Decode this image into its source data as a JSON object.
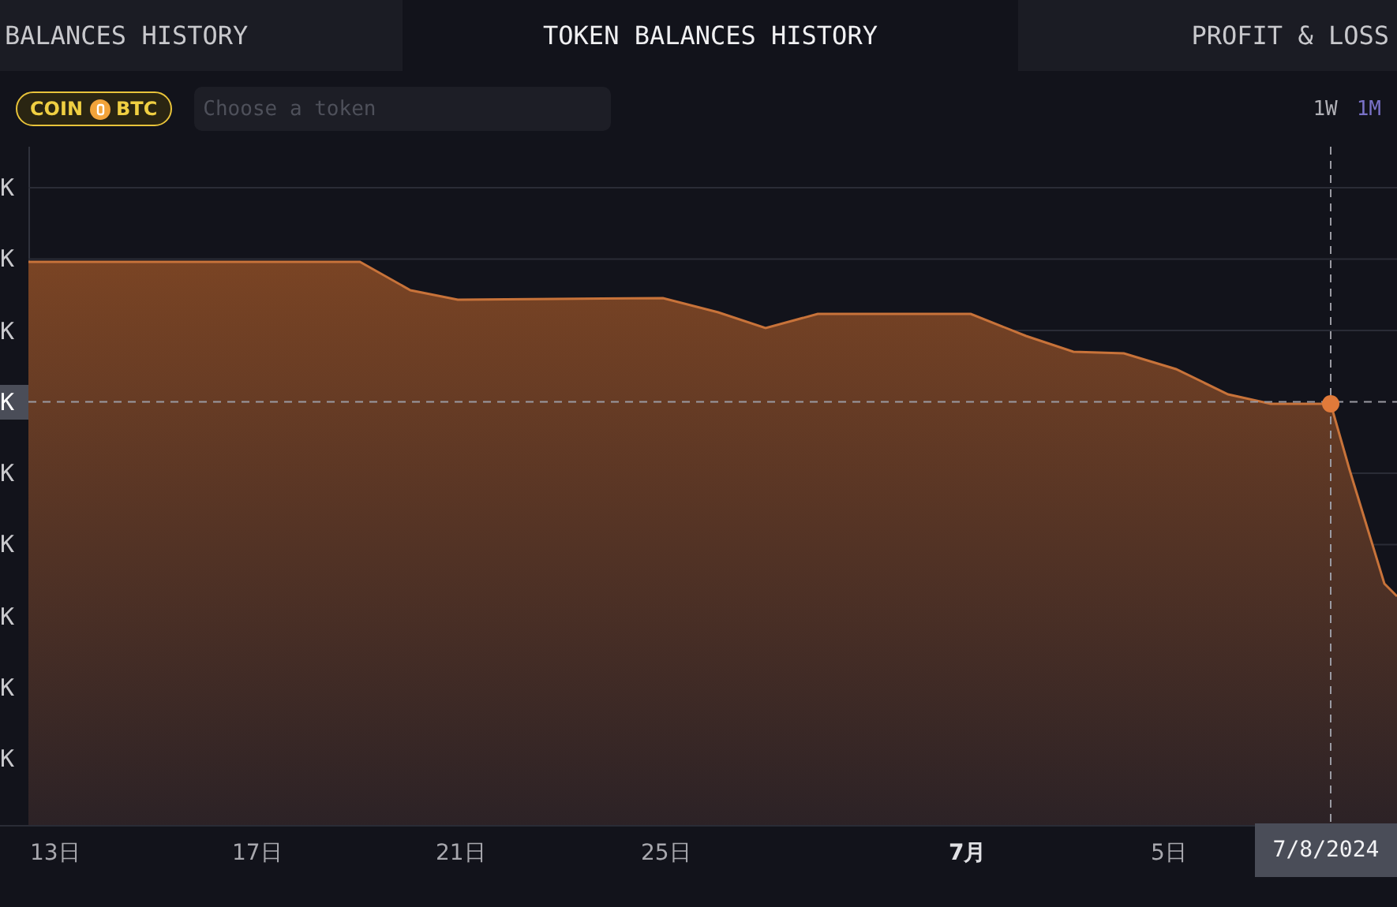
{
  "tabs": [
    {
      "label": "BALANCES HISTORY",
      "selected": false
    },
    {
      "label": "TOKEN BALANCES HISTORY",
      "selected": true
    },
    {
      "label": "PROFIT & LOSS",
      "selected": false
    }
  ],
  "coin_badge": {
    "label": "COIN",
    "symbol": "BTC"
  },
  "token_search": {
    "placeholder": "Choose a token"
  },
  "ranges": [
    {
      "label": "1W",
      "selected": false
    },
    {
      "label": "1M",
      "selected": true
    }
  ],
  "chart": {
    "y_labels": [
      {
        "text": "K",
        "highlighted": false
      },
      {
        "text": "K",
        "highlighted": false
      },
      {
        "text": "K",
        "highlighted": false
      },
      {
        "text": "K",
        "highlighted": true
      },
      {
        "text": "K",
        "highlighted": false
      },
      {
        "text": "K",
        "highlighted": false
      },
      {
        "text": "K",
        "highlighted": false
      },
      {
        "text": "K",
        "highlighted": false
      },
      {
        "text": "K",
        "highlighted": false
      }
    ],
    "x_labels": [
      {
        "text": "13日",
        "bold": false
      },
      {
        "text": "17日",
        "bold": false
      },
      {
        "text": "21日",
        "bold": false
      },
      {
        "text": "25日",
        "bold": false
      },
      {
        "text": "7月",
        "bold": true
      },
      {
        "text": "5日",
        "bold": false
      }
    ],
    "tooltip_date": "7/8/2024"
  }
}
